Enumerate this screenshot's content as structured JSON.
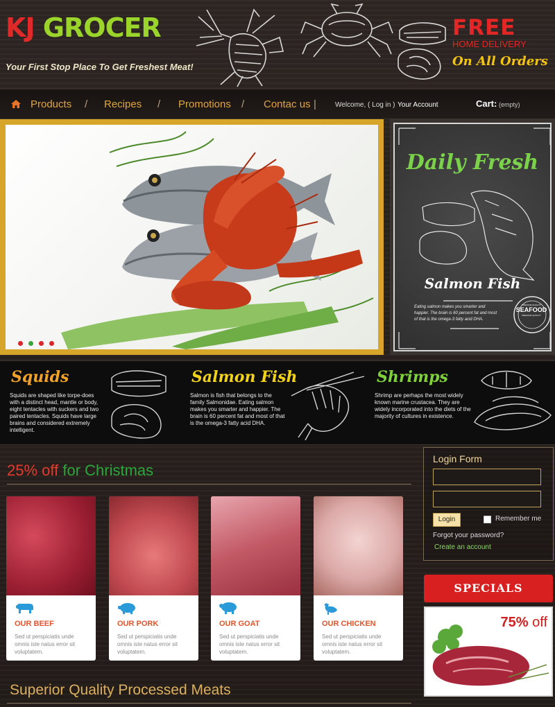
{
  "header": {
    "logo_kj": "KJ",
    "logo_grocer": "GROCER",
    "tagline": "Your First Stop Place To Get Freshest Meat!",
    "free": "FREE",
    "free_sub": "HOME DELIVERY",
    "free_orders": "On All Orders"
  },
  "nav": {
    "items": [
      "Products",
      "Recipes",
      "Promotions",
      "Contac us"
    ],
    "separator": "/",
    "bar": "|",
    "welcome": "Welcome, ( Log in )",
    "account": "Your Account",
    "cart_label": "Cart:",
    "cart_value": "(empty)"
  },
  "hero": {
    "slide_dots": [
      "active-red",
      "green",
      "red",
      "red"
    ],
    "colors": {
      "dot_red": "#d8262a",
      "dot_green": "#3aa63a"
    }
  },
  "chalkboard": {
    "title": "Daily Fresh",
    "subtitle": "Salmon Fish",
    "small_text": "Eating salmon makes you smarter and happier. The brain is 60 percent fat and most of that is the omega-3 fatty acid DHA.",
    "badge_top": "PREMIUM QUALITY",
    "badge_main": "SEAFOOD",
    "badge_bottom": "PREMIUM QUALITY"
  },
  "strip": {
    "items": [
      {
        "title": "Squids",
        "text": "Squids are shaped like torpe-does with a distinct head, mantle or body, eight tentacles with suckers and two paired tentacles. Squids have large brains and considered extremely intelligent.",
        "color": "#f2a12a"
      },
      {
        "title": "Salmon Fish",
        "text": "Salmon is fish that belongs to the family Salmonidae. Eating salmon makes you smarter and happier. The brain is 60 percent fat and most of that is the omega-3 fatty acid DHA.",
        "color": "#f3d31a"
      },
      {
        "title": "Shrimps",
        "text": "Shrimp are perhaps the most widely known marine crustacea. They are widely incorporated into the diets of the majority of cultures in existence.",
        "color": "#7fd13a"
      }
    ]
  },
  "promo": {
    "title_red": "25% off",
    "title_green": "for Christmas",
    "cards": [
      {
        "title": "OUR BEEF",
        "text": "Sed ut perspiciatis unde omnis iste natus error sit voluptatem.",
        "icon": "cow-icon"
      },
      {
        "title": "OUR PORK",
        "text": "Sed ut perspiciatis unde omnis iste natus error sit voluptatem.",
        "icon": "pig-icon"
      },
      {
        "title": "OUR GOAT",
        "text": "Sed ut perspiciatis unde omnis iste natus error sit voluptatem.",
        "icon": "sheep-icon"
      },
      {
        "title": "OUR CHICKEN",
        "text": "Sed ut perspiciatis unde omnis iste natus error sit voluptatem.",
        "icon": "chicken-icon"
      }
    ]
  },
  "login": {
    "title": "Login Form",
    "username_value": "",
    "password_value": "",
    "button": "Login",
    "remember": "Remember me",
    "forgot": "Forgot your password?",
    "create": "Create an account"
  },
  "specials": {
    "title": "SPECIALS",
    "pct": "75%",
    "off": "off"
  },
  "bottom": {
    "title": "Superior Quality Processed Meats"
  }
}
